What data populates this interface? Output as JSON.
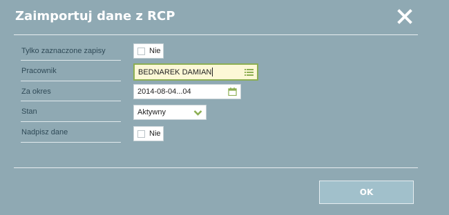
{
  "dialog": {
    "title": "Zaimportuj dane z RCP",
    "close_icon": "close-icon"
  },
  "form": {
    "only_selected": {
      "label": "Tylko zaznaczone zapisy",
      "checked": false,
      "value_text": "Nie"
    },
    "employee": {
      "label": "Pracownik",
      "value": "BEDNAREK DAMIAN",
      "icon": "list-icon"
    },
    "period": {
      "label": "Za okres",
      "value": "2014-08-04...04",
      "icon": "calendar-icon"
    },
    "status": {
      "label": "Stan",
      "value": "Aktywny",
      "icon": "chevron-down-icon"
    },
    "overwrite": {
      "label": "Nadpisz dane",
      "checked": false,
      "value_text": "Nie"
    }
  },
  "actions": {
    "ok_label": "OK"
  },
  "colors": {
    "background": "#8fa9b3",
    "accent": "#8cae52",
    "active_field_bg": "#fcf8d6"
  }
}
